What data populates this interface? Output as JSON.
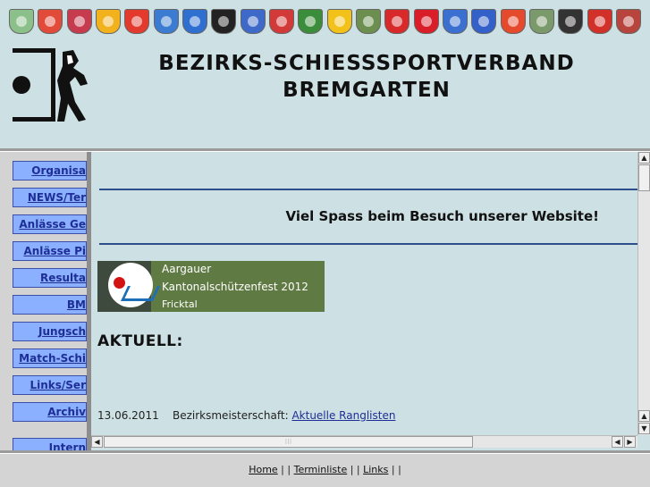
{
  "header": {
    "title_line1": "BEZIRKS-SCHIESSSPORTVERBAND",
    "title_line2": "BREMGARTEN",
    "crests": [
      {
        "name": "crest-1",
        "color": "#8cc08a"
      },
      {
        "name": "crest-2",
        "color": "#e24a3a"
      },
      {
        "name": "crest-3",
        "color": "#c73b4f"
      },
      {
        "name": "crest-4",
        "color": "#f2b21d"
      },
      {
        "name": "crest-5",
        "color": "#e23b2e"
      },
      {
        "name": "crest-6",
        "color": "#3b7bd1"
      },
      {
        "name": "crest-7",
        "color": "#2e6fcf"
      },
      {
        "name": "crest-8",
        "color": "#222222"
      },
      {
        "name": "crest-9",
        "color": "#3f69c8"
      },
      {
        "name": "crest-10",
        "color": "#d23a3a"
      },
      {
        "name": "crest-11",
        "color": "#3b8d3b"
      },
      {
        "name": "crest-12",
        "color": "#f3c21a"
      },
      {
        "name": "crest-13",
        "color": "#6c8f4f"
      },
      {
        "name": "crest-14",
        "color": "#d8292b"
      },
      {
        "name": "crest-15",
        "color": "#d91e2a"
      },
      {
        "name": "crest-16",
        "color": "#3b6fd0"
      },
      {
        "name": "crest-17",
        "color": "#3360c9"
      },
      {
        "name": "crest-18",
        "color": "#e64a2d"
      },
      {
        "name": "crest-19",
        "color": "#7a9a6b"
      },
      {
        "name": "crest-20",
        "color": "#333333"
      },
      {
        "name": "crest-21",
        "color": "#d2312a"
      },
      {
        "name": "crest-22",
        "color": "#b8443e"
      }
    ]
  },
  "nav": {
    "items": [
      {
        "label": "Organisa",
        "name": "nav-organisation"
      },
      {
        "label": "NEWS/Ter",
        "name": "nav-news-termine"
      },
      {
        "label": "Anlässe Ge",
        "name": "nav-anlaesse-gewehr"
      },
      {
        "label": "Anlässe Pi",
        "name": "nav-anlaesse-pistole"
      },
      {
        "label": "Resulta",
        "name": "nav-resultate"
      },
      {
        "label": "BM",
        "name": "nav-bm"
      },
      {
        "label": "Jungsch",
        "name": "nav-jungschuetzen"
      },
      {
        "label": "Match-Schi",
        "name": "nav-match-schiessen"
      },
      {
        "label": "Links/Ser",
        "name": "nav-links-service"
      },
      {
        "label": "Archiv",
        "name": "nav-archiv"
      },
      {
        "label": "Intern",
        "name": "nav-intern"
      }
    ]
  },
  "main": {
    "welcome": "Viel Spass beim Besuch unserer Website!",
    "banner": {
      "line1": "Aargauer",
      "line2": "Kantonalschützenfest 2012",
      "line3": "Fricktal"
    },
    "aktuell_heading": "AKTUELL:",
    "news": [
      {
        "date": "13.06.2011",
        "text": "Bezirksmeisterschaft:",
        "link": "Aktuelle Ranglisten"
      }
    ]
  },
  "footer": {
    "home": "Home",
    "terminliste": "Terminliste",
    "links": "Links",
    "sep1": " | | ",
    "sep2": " | | ",
    "sep3": " | |"
  }
}
